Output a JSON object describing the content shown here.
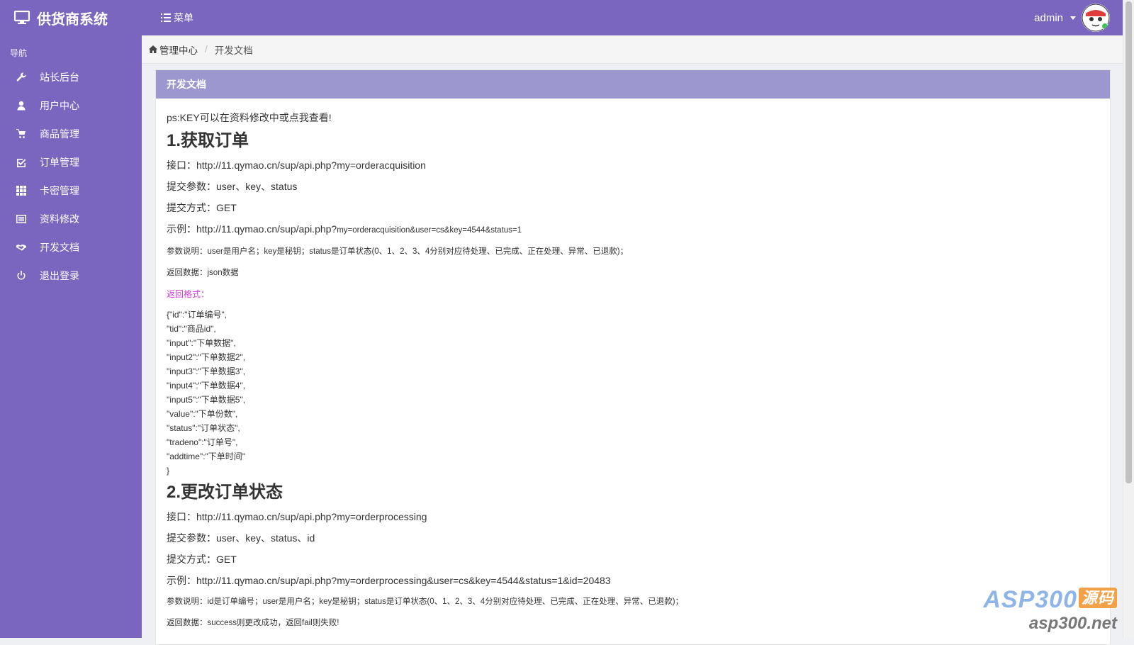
{
  "topbar": {
    "brand": "供货商系统",
    "menu_label": "菜单",
    "username": "admin"
  },
  "sidebar": {
    "header": "导航",
    "items": [
      {
        "label": "站长后台",
        "icon": "wrench-icon"
      },
      {
        "label": "用户中心",
        "icon": "user-icon"
      },
      {
        "label": "商品管理",
        "icon": "cart-icon"
      },
      {
        "label": "订单管理",
        "icon": "check-square-icon"
      },
      {
        "label": "卡密管理",
        "icon": "grid-icon"
      },
      {
        "label": "资料修改",
        "icon": "list-alt-icon"
      },
      {
        "label": "开发文档",
        "icon": "handshake-icon"
      },
      {
        "label": "退出登录",
        "icon": "power-icon"
      }
    ]
  },
  "breadcrumb": {
    "home": "管理中心",
    "separator": "/",
    "current": "开发文档"
  },
  "panel": {
    "title": "开发文档",
    "ps": "ps:KEY可以在资料修改中或点我查看!",
    "sections": [
      {
        "heading": "1.获取订单",
        "endpoint_label": "接口：",
        "endpoint": "http://11.qymao.cn/sup/api.php?my=orderacquisition",
        "params": "提交参数：user、key、status",
        "method": "提交方式：GET",
        "example_label": "示例：",
        "example_base": "http://11.qymao.cn/sup/api.php?",
        "example_query": "my=orderacquisition&user=cs&key=4544&status=1",
        "desc": "参数说明：user是用户名；key是秘钥；status是订单状态(0、1、2、3、4分别对应待处理、已完成、正在处理、异常、已退款)；",
        "returns": "返回数据：json数据",
        "format_label": "返回格式：",
        "format_lines": [
          "{\"id\":\"订单编号\",",
          "\"tid\":\"商品id\",",
          "\"input\":\"下单数据\",",
          "\"input2\":\"下单数据2\",",
          "\"input3\":\"下单数据3\",",
          "\"input4\":\"下单数据4\",",
          "\"input5\":\"下单数据5\",",
          "\"value\":\"下单份数\",",
          "\"status\":\"订单状态\",",
          "\"tradeno\":\"订单号\",",
          "\"addtime\":\"下单时间\"",
          "}"
        ]
      },
      {
        "heading": "2.更改订单状态",
        "endpoint_label": "接口：",
        "endpoint": "http://11.qymao.cn/sup/api.php?my=orderprocessing",
        "params": "提交参数：user、key、status、id",
        "method": "提交方式：GET",
        "example_label": "示例：",
        "example": "http://11.qymao.cn/sup/api.php?my=orderprocessing&user=cs&key=4544&status=1&id=20483",
        "desc": "参数说明：id是订单编号；user是用户名；key是秘钥；status是订单状态(0、1、2、3、4分别对应待处理、已完成、正在处理、异常、已退款)；",
        "returns": "返回数据：success则更改成功，返回fail则失败!"
      }
    ]
  },
  "watermark": {
    "brand": "ASP300",
    "tag": "源码",
    "url": "asp300.net"
  },
  "colors": {
    "primary": "#7a66bf",
    "panel_heading": "#9d97cf",
    "highlight": "#d63ad8"
  }
}
